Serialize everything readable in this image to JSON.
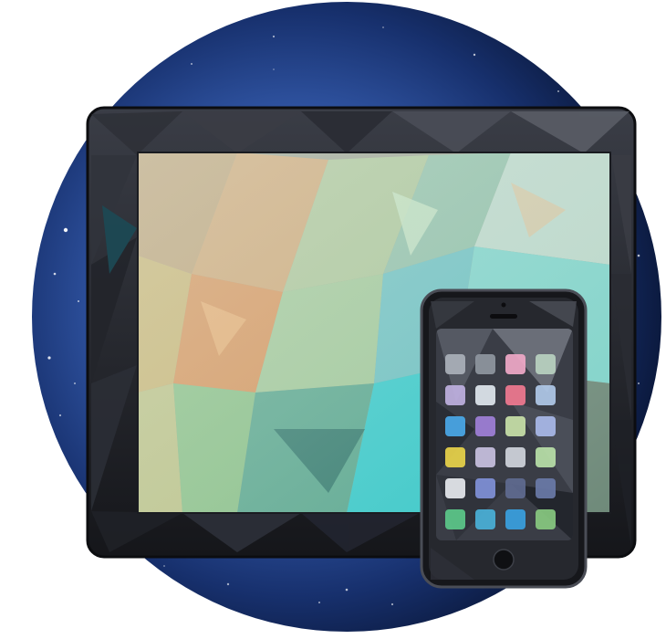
{
  "scene": {
    "subject": "tablet-and-phone-with-geometric-wallpaper",
    "backdrop": "starry-space-circle"
  },
  "colors": {
    "space_deep": "#0b1a3f",
    "space_light": "#3a63b8",
    "device_frame": "#1c1d22",
    "device_bezel": "#2a2c33",
    "teal": "#3cc8c8",
    "sand": "#c9a97a",
    "sage": "#9fc79a",
    "pink": "#f0a8c8",
    "yellow": "#e8d24a",
    "sky": "#4aa8e8",
    "violet": "#a07fd8",
    "green": "#5cc88a"
  },
  "phone": {
    "app_icon_colors": [
      "#aab0b8",
      "#8f96a0",
      "#f0a8c8",
      "#b9d0c0",
      "#bfb0e0",
      "#e0e6ee",
      "#f07890",
      "#b0c8e8",
      "#4aa8e8",
      "#a07fd8",
      "#c8e0a8",
      "#a8b8e8",
      "#e8d24a",
      "#c8c0e0",
      "#d0d4dc",
      "#b8e0a8",
      "#e6e8ee",
      "#8090d8",
      "#5f6a90",
      "#6a7aa8",
      "#5cc88a",
      "#4ab0d8",
      "#3aa0e0",
      "#88c880"
    ]
  }
}
